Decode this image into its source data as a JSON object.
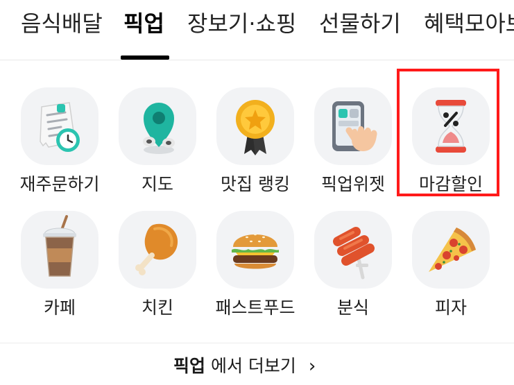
{
  "tabs": [
    {
      "label": "음식배달",
      "active": false
    },
    {
      "label": "픽업",
      "active": true
    },
    {
      "label": "장보기·쇼핑",
      "active": false
    },
    {
      "label": "선물하기",
      "active": false
    },
    {
      "label": "혜택모아보",
      "active": false
    }
  ],
  "categories": [
    {
      "label": "재주문하기",
      "icon": "receipt-clock-icon"
    },
    {
      "label": "지도",
      "icon": "map-pin-icon"
    },
    {
      "label": "맛집 랭킹",
      "icon": "medal-icon"
    },
    {
      "label": "픽업위젯",
      "icon": "phone-widget-icon"
    },
    {
      "label": "마감할인",
      "icon": "hourglass-percent-icon",
      "highlighted": true
    },
    {
      "label": "카페",
      "icon": "iced-coffee-icon"
    },
    {
      "label": "치킨",
      "icon": "fried-chicken-icon"
    },
    {
      "label": "패스트푸드",
      "icon": "burger-icon"
    },
    {
      "label": "분식",
      "icon": "tteokbokki-skewer-icon"
    },
    {
      "label": "피자",
      "icon": "pizza-slice-icon"
    }
  ],
  "more": {
    "bold": "픽업",
    "rest": " 에서 더보기",
    "chevron": "›"
  },
  "colors": {
    "highlight": "#ff1a1a",
    "tile_bg": "#f2f3f5",
    "text": "#1a1a1a"
  }
}
